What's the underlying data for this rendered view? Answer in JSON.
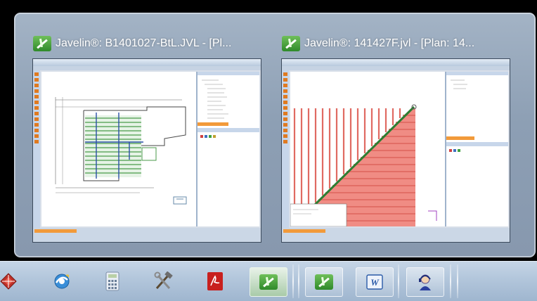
{
  "switcher": {
    "windows": [
      {
        "title": "Javelin®: B1401027-BtL.JVL - [Pl...",
        "app_icon": "javelin-icon"
      },
      {
        "title": "Javelin®: 141427F.jvl - [Plan: 14...",
        "app_icon": "javelin-icon"
      }
    ]
  },
  "taskbar": {
    "buttons": [
      {
        "icon": "red-diamond-app-icon",
        "state": "pinned"
      },
      {
        "icon": "ie-browser-icon",
        "state": "pinned"
      },
      {
        "icon": "calculator-icon",
        "state": "pinned"
      },
      {
        "icon": "hammer-wrench-tools-icon",
        "state": "pinned"
      },
      {
        "icon": "pdf-icon",
        "state": "pinned"
      },
      {
        "icon": "javelin-icon",
        "state": "active"
      },
      {
        "icon": "javelin-icon",
        "state": "open"
      },
      {
        "icon": "word-icon",
        "state": "open"
      },
      {
        "icon": "support-agent-icon",
        "state": "open"
      }
    ]
  },
  "colors": {
    "glass": "#8d9fb4",
    "taskbar": "#b0c4da",
    "joist_green": "#4a9a4a",
    "joist_red": "#f08c84",
    "orange_accent": "#f29a3a"
  }
}
